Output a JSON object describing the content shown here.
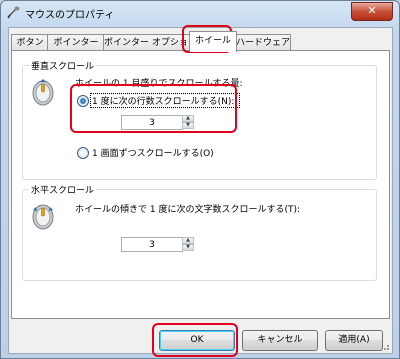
{
  "window": {
    "title": "マウスのプロパティ",
    "close_label": "✕"
  },
  "tabs": [
    {
      "label": "ボタン"
    },
    {
      "label": "ポインター"
    },
    {
      "label": "ポインター オプション"
    },
    {
      "label": "ホイール",
      "active": true
    },
    {
      "label": "ハードウェア"
    }
  ],
  "vertical": {
    "group_title": "垂直スクロール",
    "heading": "ホイールの 1 目盛りでスクロールする量:",
    "option_lines_label": "1 度に次の行数スクロールする(N):",
    "option_lines_selected": true,
    "lines_value": "3",
    "option_page_label": "1 画面ずつスクロールする(O)",
    "option_page_selected": false
  },
  "horizontal": {
    "group_title": "水平スクロール",
    "heading": "ホイールの傾きで 1 度に次の文字数スクロールする(T):",
    "chars_value": "3"
  },
  "buttons": {
    "ok": "OK",
    "cancel": "キャンセル",
    "apply": "適用(A)"
  },
  "colors": {
    "highlight": "#e2001a",
    "selected_radio": "#1c5aa3"
  },
  "icons": {
    "title": "mouse-icon",
    "wheel": "mouse-wheel-icon"
  }
}
